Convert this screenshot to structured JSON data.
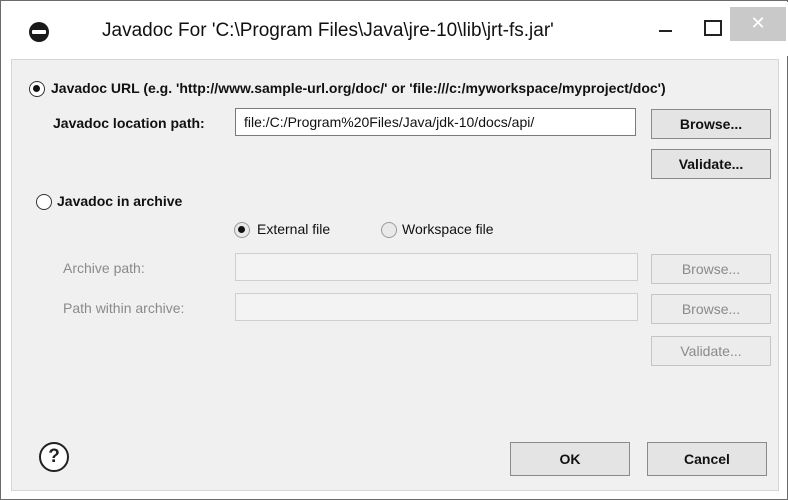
{
  "window": {
    "title": "Javadoc For 'C:\\Program Files\\Java\\jre-10\\lib\\jrt-fs.jar'",
    "minimize_glyph": "–",
    "maximize_glyph": "□",
    "close_glyph": "✕"
  },
  "url_section": {
    "radio_label": "Javadoc URL (e.g. 'http://www.sample-url.org/doc/' or 'file:///c:/myworkspace/myproject/doc')",
    "selected": true,
    "location_label": "Javadoc location path:",
    "location_value": "file:/C:/Program%20Files/Java/jdk-10/docs/api/",
    "browse_label": "Browse...",
    "validate_label": "Validate..."
  },
  "archive_section": {
    "radio_label": "Javadoc in archive",
    "selected": false,
    "external_file_label": "External file",
    "external_file_selected": true,
    "workspace_file_label": "Workspace file",
    "workspace_file_selected": false,
    "archive_path_label": "Archive path:",
    "archive_path_value": "",
    "archive_browse_label": "Browse...",
    "path_within_label": "Path within archive:",
    "path_within_value": "",
    "path_within_browse_label": "Browse...",
    "validate_label": "Validate..."
  },
  "footer": {
    "help_glyph": "?",
    "ok_label": "OK",
    "cancel_label": "Cancel"
  }
}
